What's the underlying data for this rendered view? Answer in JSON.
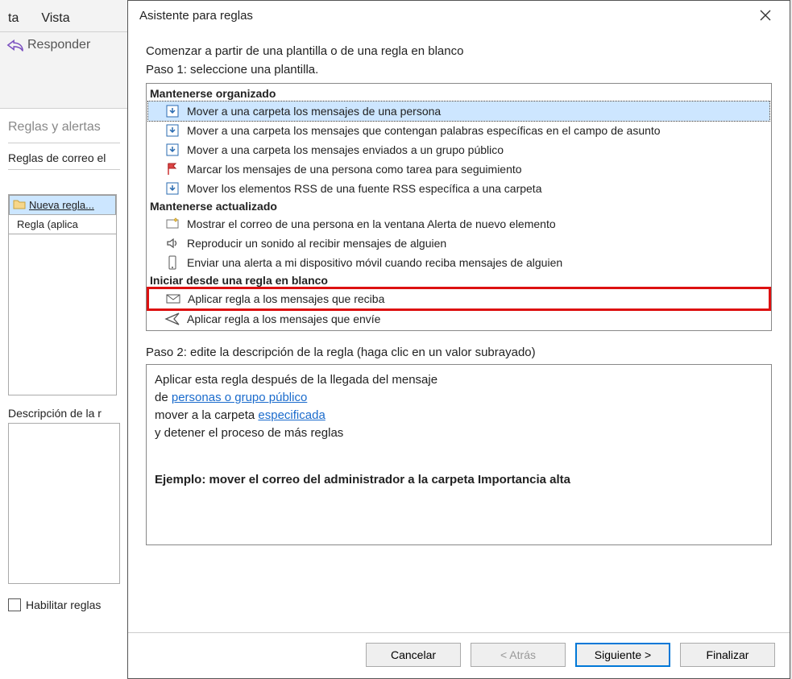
{
  "background": {
    "tabs": [
      "ta",
      "Vista"
    ],
    "reply": "Responder",
    "rules_alerts": "Reglas y alertas",
    "panel_title": "Reglas de correo el",
    "new_rule": "Nueva regla...",
    "col_header": "Regla (aplica",
    "desc_label": "Descripción de la r",
    "enable": "Habilitar reglas"
  },
  "dialog": {
    "title": "Asistente para reglas",
    "intro": "Comenzar a partir de una plantilla o de una regla en blanco",
    "step1": "Paso 1: seleccione una plantilla.",
    "sections": {
      "organized": "Mantenerse organizado",
      "updated": "Mantenerse actualizado",
      "blank": "Iniciar desde una regla en blanco"
    },
    "items": {
      "org0": "Mover a una carpeta los mensajes de una persona",
      "org1": "Mover a una carpeta los mensajes que contengan palabras específicas en el campo de asunto",
      "org2": "Mover a una carpeta los mensajes enviados a un grupo público",
      "org3": "Marcar los mensajes de una persona como tarea para seguimiento",
      "org4": "Mover los elementos RSS de una fuente RSS específica a una carpeta",
      "upd0": "Mostrar el correo de una persona en la ventana Alerta de nuevo elemento",
      "upd1": "Reproducir un sonido al recibir mensajes de alguien",
      "upd2": "Enviar una alerta a mi dispositivo móvil cuando reciba mensajes de alguien",
      "blk0": "Aplicar regla a los mensajes que reciba",
      "blk1": "Aplicar regla a los mensajes que envíe"
    },
    "step2": "Paso 2: edite la descripción de la regla (haga clic en un valor subrayado)",
    "desc": {
      "line1": "Aplicar esta regla después de la llegada del mensaje",
      "line2_prefix": "de ",
      "line2_link": "personas o grupo público",
      "line3_prefix": "mover a la carpeta ",
      "line3_link": "especificada",
      "line4": " y detener el proceso de más reglas",
      "example": "Ejemplo: mover el correo del administrador a la carpeta Importancia alta"
    },
    "buttons": {
      "cancel": "Cancelar",
      "back": "< Atrás",
      "next": "Siguiente >",
      "finish": "Finalizar"
    }
  }
}
